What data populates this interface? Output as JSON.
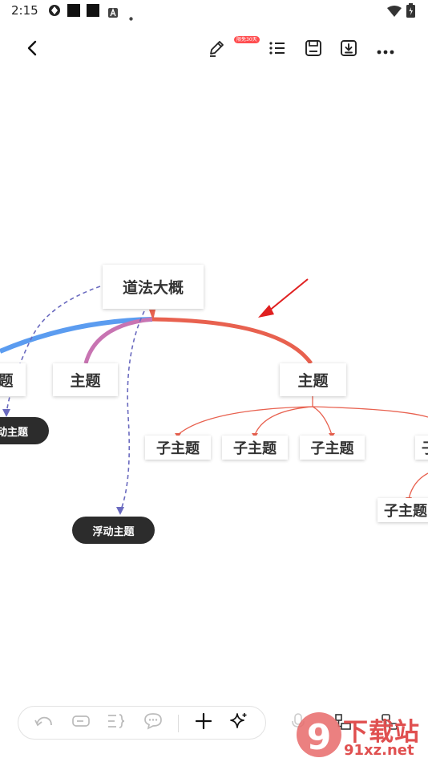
{
  "status_bar": {
    "time": "2:15",
    "icons": [
      "aperture-icon",
      "black-square-icon",
      "black-square-icon",
      "a-badge-icon",
      "dot-icon",
      "wifi-icon",
      "battery-icon"
    ]
  },
  "toolbar": {
    "icons": [
      "back-icon",
      "pen-icon",
      "list-icon",
      "save-icon",
      "download-icon",
      "more-icon"
    ],
    "badge": "限免30天"
  },
  "mindmap": {
    "root": "道法大概",
    "left_topic_partial": "题",
    "topic_middle": "主题",
    "topic_right": "主题",
    "subtopics": [
      "子主题",
      "子主题",
      "子主题"
    ],
    "subtopic_right_partial": "子",
    "subtopic_lower_right": "子主题",
    "floating_left_partial": "动主题",
    "floating_bottom": "浮动主题"
  },
  "bottom_toolbar": {
    "icons": [
      "undo-icon",
      "text-box-icon",
      "bracket-icon",
      "comment-icon",
      "add-icon",
      "sparkle-icon",
      "mic-icon",
      "layout-icon",
      "structure-icon"
    ]
  },
  "watermark": {
    "logo": "9",
    "brand": "下载站",
    "domain": "91xz.net"
  },
  "colors": {
    "red_branch": "#e8614f",
    "blue_branch": "#5b9cf0",
    "purple_branch": "#c874b2",
    "dashed_line": "#6a6abf",
    "arrow": "#e02020",
    "float_bg": "#2c2c2c"
  }
}
